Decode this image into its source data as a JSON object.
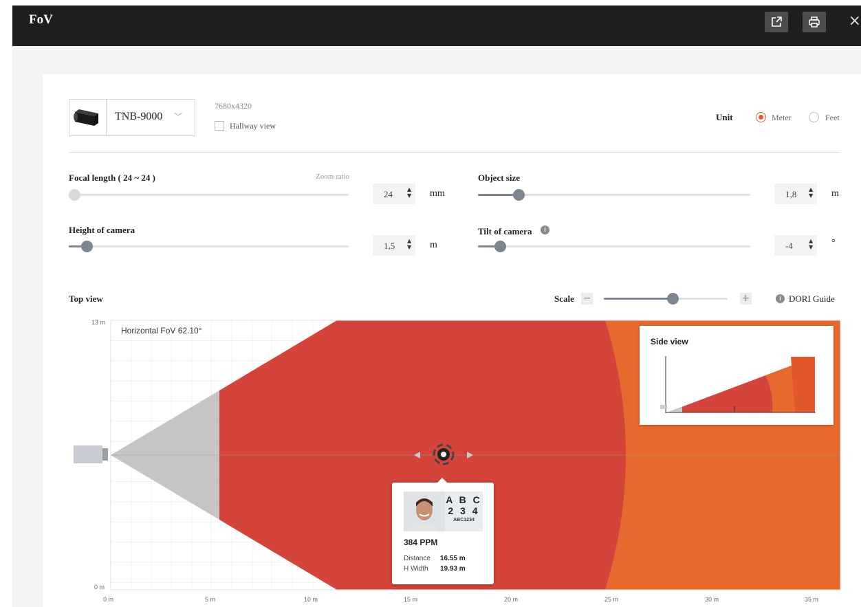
{
  "window": {
    "title": "FoV",
    "close_glyph": "×"
  },
  "toolbar": {
    "icons": [
      "external-link-icon",
      "print-icon"
    ]
  },
  "camera": {
    "model": "TNB-9000",
    "resolution": "7680x4320",
    "hallway_view_label": "Hallway view",
    "hallway_view_checked": false
  },
  "unit": {
    "label": "Unit",
    "options": [
      "Meter",
      "Feet"
    ],
    "selected": "Meter"
  },
  "controls": {
    "focal_length": {
      "label": "Focal length ( 24 ~ 24 )",
      "zoom_ratio_label": "Zoom ratio",
      "value": "24",
      "unit": "mm"
    },
    "object_size": {
      "label": "Object size",
      "value": "1,8",
      "unit": "m"
    },
    "height_of_camera": {
      "label": "Height of camera",
      "value": "1,5",
      "unit": "m"
    },
    "tilt_of_camera": {
      "label": "Tilt of camera",
      "value": "-4",
      "unit": "°"
    }
  },
  "top_view": {
    "label": "Top view",
    "scale_label": "Scale",
    "scale_minus": "−",
    "scale_plus": "+",
    "dori_label": "DORI Guide",
    "fov_text": "Horizontal FoV 62.10°",
    "y_axis": [
      "13 m",
      "0 m"
    ],
    "x_axis": [
      "0 m",
      "5 m",
      "10 m",
      "15 m",
      "20 m",
      "25 m",
      "30 m",
      "35 m"
    ]
  },
  "side_view": {
    "title": "Side view"
  },
  "tooltip": {
    "plate_line1": "A B C",
    "plate_line2": "2 3 4",
    "plate_line3": "ABC1234",
    "ppm": "384 PPM",
    "distance_label": "Distance",
    "distance_value": "16.55 m",
    "hwidth_label": "H Width",
    "hwidth_value": "19.93 m"
  },
  "colors": {
    "accent": "#e85a2c",
    "zone_red": "#d4443a",
    "zone_orange": "#e8692e",
    "titlebar": "#1e1e1e"
  }
}
